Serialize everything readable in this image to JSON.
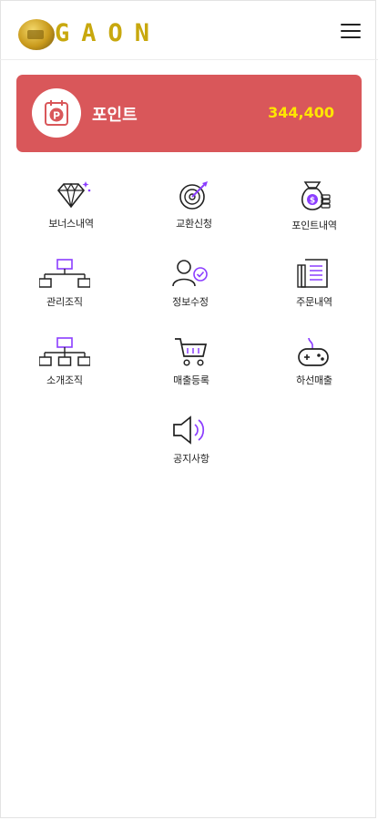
{
  "header": {
    "logo_text": "GAON",
    "menu_icon": "hamburger-menu-icon"
  },
  "points": {
    "icon": "point-coin-calendar-icon",
    "label": "포인트",
    "value": "344,400",
    "card_color": "#d9575a",
    "value_color": "#ffe600"
  },
  "menu": {
    "items": [
      {
        "label": "보너스내역",
        "icon": "diamond-icon"
      },
      {
        "label": "교환신청",
        "icon": "target-icon"
      },
      {
        "label": "포인트내역",
        "icon": "money-bag-icon"
      },
      {
        "label": "관리조직",
        "icon": "org-chart-icon"
      },
      {
        "label": "정보수정",
        "icon": "user-check-icon"
      },
      {
        "label": "주문내역",
        "icon": "order-document-icon"
      },
      {
        "label": "소개조직",
        "icon": "referral-org-icon"
      },
      {
        "label": "매출등록",
        "icon": "shopping-cart-icon"
      },
      {
        "label": "하선매출",
        "icon": "gamepad-icon"
      },
      {
        "label": "공지사항",
        "icon": "speaker-icon"
      }
    ]
  },
  "colors": {
    "accent_purple": "#8b3dff",
    "icon_dark": "#222222"
  }
}
